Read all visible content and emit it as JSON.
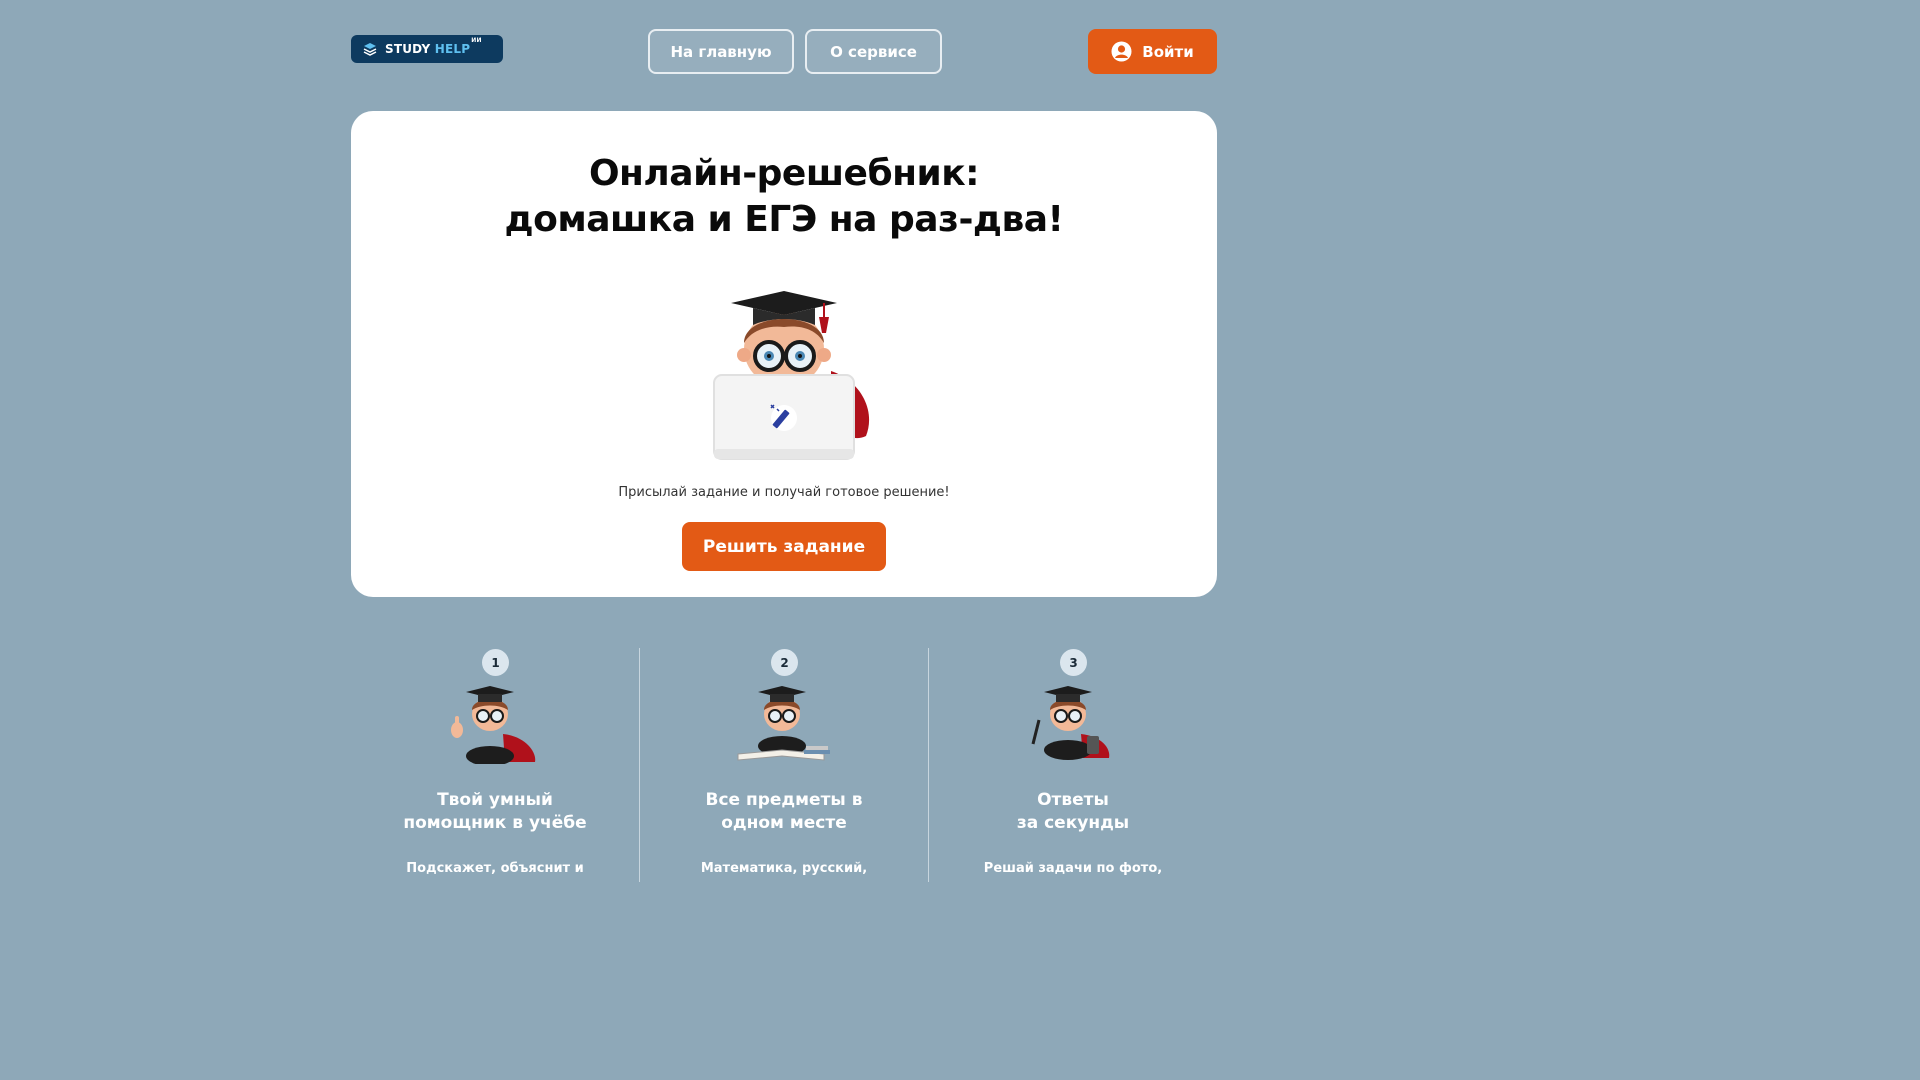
{
  "header": {
    "logo": {
      "study": "STUDY",
      "help": "HELP",
      "sup": "ИИ"
    },
    "nav": {
      "home": "На главную",
      "about": "О сервисе"
    },
    "login": "Войти"
  },
  "hero": {
    "title_line1": "Онлайн-решебник:",
    "title_line2": "домашка и ЕГЭ на раз-два!",
    "subtitle": "Присылай задание и получай готовое решение!",
    "cta": "Решить задание"
  },
  "features": [
    {
      "number": "1",
      "title_line1": "Твой умный",
      "title_line2": "помощник в учёбе",
      "text": "Подскажет, объяснит и"
    },
    {
      "number": "2",
      "title_line1": "Все предметы в",
      "title_line2": "одном месте",
      "text": "Математика, русский,"
    },
    {
      "number": "3",
      "title_line1": "Ответы",
      "title_line2": "за секунды",
      "text": "Решай задачи по фото,"
    }
  ],
  "colors": {
    "background": "#8ea8b8",
    "accent": "#e35a15",
    "logo_bg": "#0d3a5f"
  }
}
